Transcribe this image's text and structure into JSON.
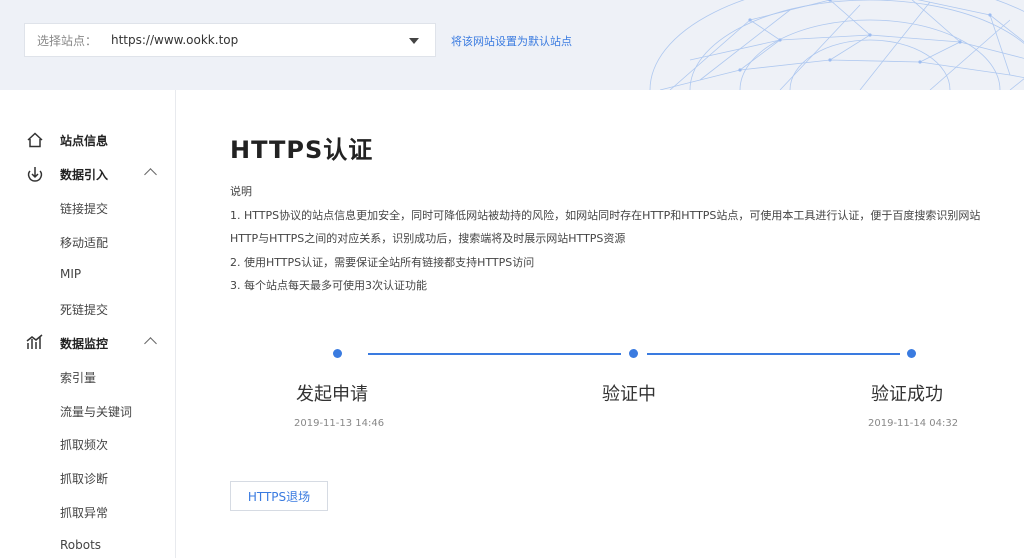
{
  "site_selector": {
    "label": "选择站点：",
    "value": "https://www.ookk.top"
  },
  "set_default_link": "将该网站设置为默认站点",
  "sidebar": {
    "site_info": "站点信息",
    "data_import": {
      "label": "数据引入",
      "items": [
        "链接提交",
        "移动适配",
        "MIP",
        "死链提交"
      ]
    },
    "data_monitor": {
      "label": "数据监控",
      "items": [
        "索引量",
        "流量与关键词",
        "抓取频次",
        "抓取诊断",
        "抓取异常",
        "Robots"
      ]
    }
  },
  "main": {
    "title": "HTTPS认证",
    "desc_heading": "说明",
    "desc_lines": [
      "1. HTTPS协议的站点信息更加安全，同时可降低网站被劫持的风险，如网站同时存在HTTP和HTTPS站点，可使用本工具进行认证，便于百度搜索识别网站",
      "HTTP与HTTPS之间的对应关系，识别成功后，搜索端将及时展示网站HTTPS资源",
      "2. 使用HTTPS认证，需要保证全站所有链接都支持HTTPS访问",
      "3. 每个站点每天最多可使用3次认证功能"
    ],
    "steps": [
      {
        "label": "发起申请",
        "time": "2019-11-13 14:46"
      },
      {
        "label": "验证中",
        "time": ""
      },
      {
        "label": "验证成功",
        "time": "2019-11-14 04:32"
      }
    ],
    "exit_button": "HTTPS退场"
  },
  "colors": {
    "accent": "#3a7be0",
    "topbar_bg": "#eef1f7"
  }
}
